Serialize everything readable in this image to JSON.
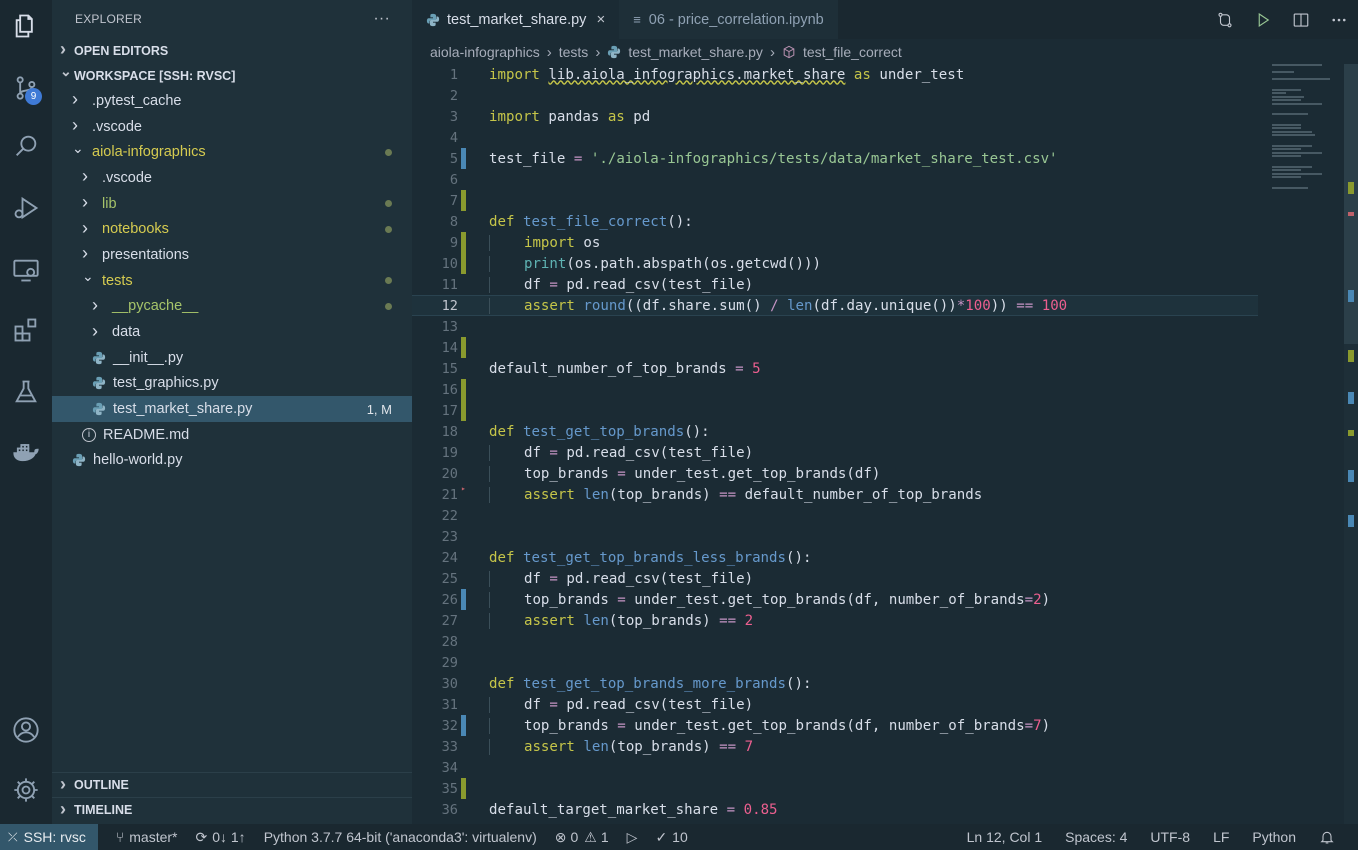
{
  "activity_bar": {
    "scm_badge": "9"
  },
  "sidebar": {
    "title": "EXPLORER",
    "more": "···",
    "open_editors": "OPEN EDITORS",
    "workspace": "WORKSPACE [SSH: RVSC]",
    "tree": [
      {
        "label": ".pytest_cache",
        "depth": 1,
        "kind": "folder",
        "open": false
      },
      {
        "label": ".vscode",
        "depth": 1,
        "kind": "folder",
        "open": false
      },
      {
        "label": "aiola-infographics",
        "depth": 1,
        "kind": "folder",
        "open": true,
        "color": "yellow",
        "dot": true
      },
      {
        "label": ".vscode",
        "depth": 2,
        "kind": "folder",
        "open": false
      },
      {
        "label": "lib",
        "depth": 2,
        "kind": "folder",
        "open": false,
        "color": "green",
        "dot": true
      },
      {
        "label": "notebooks",
        "depth": 2,
        "kind": "folder",
        "open": false,
        "color": "yellow",
        "dot": true
      },
      {
        "label": "presentations",
        "depth": 2,
        "kind": "folder",
        "open": false
      },
      {
        "label": "tests",
        "depth": 2,
        "kind": "folder",
        "open": true,
        "color": "yellow",
        "dot": true
      },
      {
        "label": "__pycache__",
        "depth": 3,
        "kind": "folder",
        "open": false,
        "color": "green",
        "dot": true
      },
      {
        "label": "data",
        "depth": 3,
        "kind": "folder",
        "open": false
      },
      {
        "label": "__init__.py",
        "depth": 3,
        "kind": "py"
      },
      {
        "label": "test_graphics.py",
        "depth": 3,
        "kind": "py"
      },
      {
        "label": "test_market_share.py",
        "depth": 3,
        "kind": "py",
        "selected": true,
        "status": "1, M"
      },
      {
        "label": "README.md",
        "depth": 2,
        "kind": "info"
      },
      {
        "label": "hello-world.py",
        "depth": 1,
        "kind": "py"
      }
    ],
    "outline": "OUTLINE",
    "timeline": "TIMELINE"
  },
  "tabs": {
    "active": "test_market_share.py",
    "close": "×",
    "inactive": "06 - price_correlation.ipynb"
  },
  "breadcrumb": [
    "aiola-infographics",
    "tests",
    "test_market_share.py",
    "test_file_correct"
  ],
  "code_lines": [
    "1",
    "2",
    "3",
    "4",
    "5",
    "6",
    "7",
    "8",
    "9",
    "10",
    "11",
    "12",
    "13",
    "14",
    "15",
    "16",
    "17",
    "18",
    "19",
    "20",
    "21",
    "22",
    "23",
    "24",
    "25",
    "26",
    "27",
    "28",
    "29",
    "30",
    "31",
    "32",
    "33",
    "34",
    "35",
    "36"
  ],
  "status_bar": {
    "remote": "SSH: rvsc",
    "branch": "master*",
    "sync": "0↓ 1↑",
    "python": "Python 3.7.7 64-bit ('anaconda3': virtualenv)",
    "errors": "0",
    "warnings": "1",
    "tests": "10",
    "position": "Ln 12, Col 1",
    "spaces": "Spaces: 4",
    "encoding": "UTF-8",
    "eol": "LF",
    "language": "Python"
  }
}
